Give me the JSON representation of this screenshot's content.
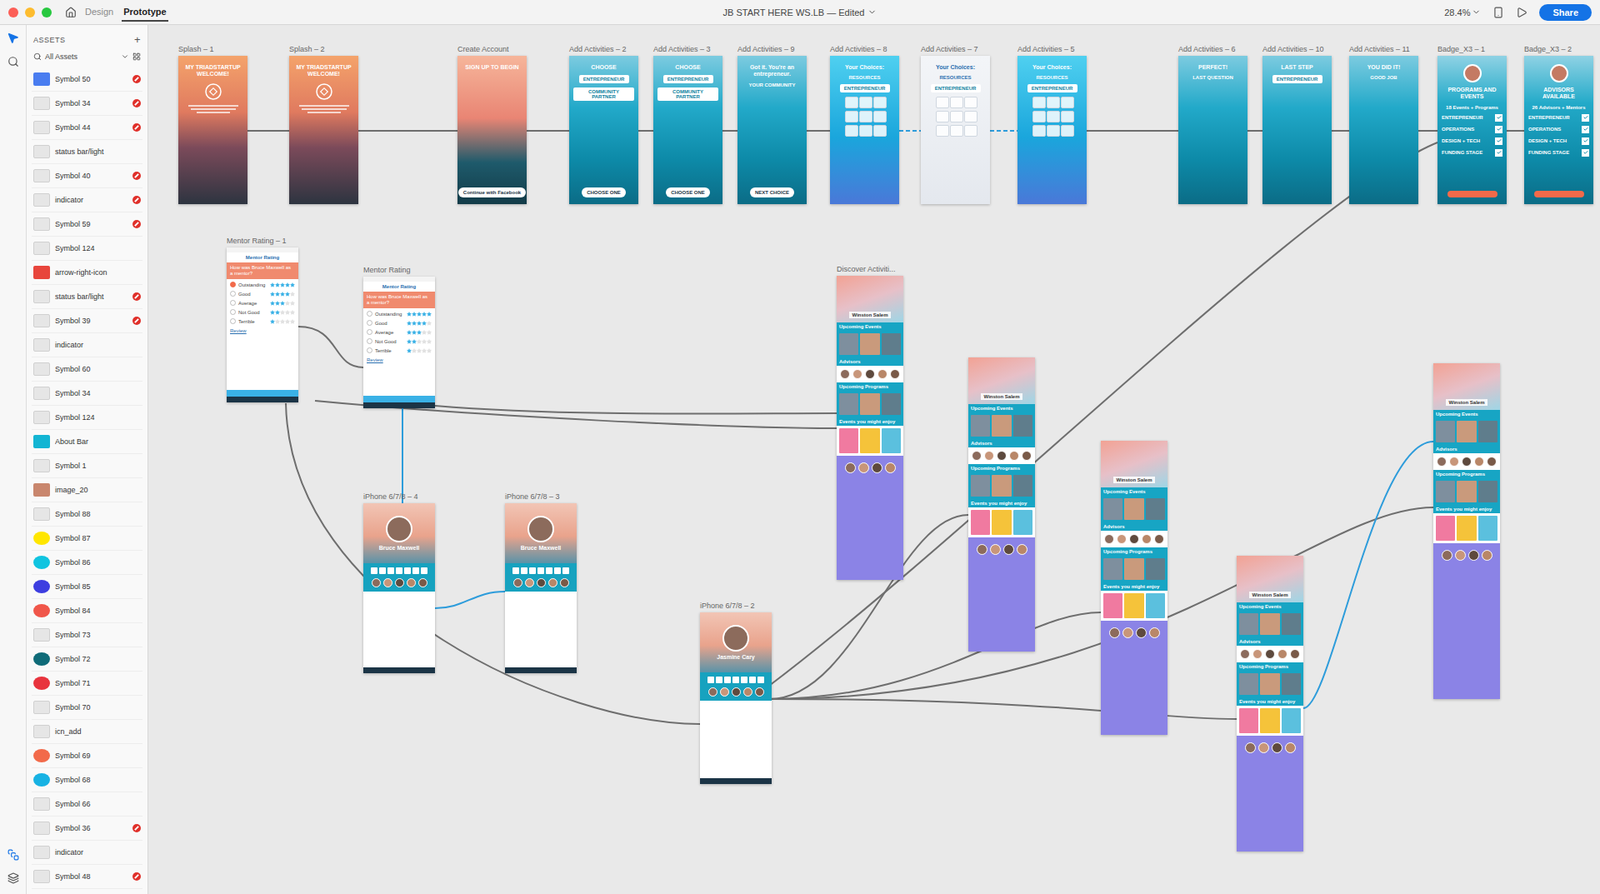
{
  "window": {
    "title": "JB START HERE WS.LB — Edited",
    "tabs": [
      {
        "label": "Design",
        "selected": false
      },
      {
        "label": "Prototype",
        "selected": true
      }
    ],
    "zoom": "28.4%",
    "share": "Share"
  },
  "tools": [
    {
      "selected": true
    },
    {
      "selected": false
    }
  ],
  "assets": {
    "title": "ASSETS",
    "add": "+",
    "filter": "All Assets",
    "items": [
      {
        "name": "Symbol 50",
        "broken": true,
        "color": "#4a7df0"
      },
      {
        "name": "Symbol 34",
        "broken": true
      },
      {
        "name": "Symbol 44",
        "broken": true
      },
      {
        "name": "status bar/light",
        "broken": false
      },
      {
        "name": "Symbol 40",
        "broken": true
      },
      {
        "name": "indicator",
        "broken": true
      },
      {
        "name": "Symbol 59",
        "broken": true
      },
      {
        "name": "Symbol 124",
        "broken": false
      },
      {
        "name": "arrow-right-icon",
        "broken": false,
        "color": "#e8453c"
      },
      {
        "name": "status bar/light",
        "broken": true
      },
      {
        "name": "Symbol 39",
        "broken": true
      },
      {
        "name": "indicator",
        "broken": false
      },
      {
        "name": "Symbol 60",
        "broken": false
      },
      {
        "name": "Symbol 34",
        "broken": false
      },
      {
        "name": "Symbol 124",
        "broken": false
      },
      {
        "name": "About Bar",
        "broken": false,
        "color": "#13b5d3"
      },
      {
        "name": "Symbol 1",
        "broken": false
      },
      {
        "name": "image_20",
        "broken": false,
        "color": "#c9866d"
      },
      {
        "name": "Symbol 88",
        "broken": false
      },
      {
        "name": "Symbol 87",
        "broken": false,
        "color": "#ffe600"
      },
      {
        "name": "Symbol 86",
        "broken": false,
        "color": "#10c4e0"
      },
      {
        "name": "Symbol 85",
        "broken": false,
        "color": "#3d3ee0"
      },
      {
        "name": "Symbol 84",
        "broken": false,
        "color": "#f0564a"
      },
      {
        "name": "Symbol 73",
        "broken": false
      },
      {
        "name": "Symbol 72",
        "broken": false,
        "color": "#0f6b78"
      },
      {
        "name": "Symbol 71",
        "broken": false,
        "color": "#e8333d"
      },
      {
        "name": "Symbol 70",
        "broken": false
      },
      {
        "name": "icn_add",
        "broken": false
      },
      {
        "name": "Symbol 69",
        "broken": false,
        "color": "#f26a4a"
      },
      {
        "name": "Symbol 68",
        "broken": false,
        "color": "#17b2e3"
      },
      {
        "name": "Symbol 66",
        "broken": false
      },
      {
        "name": "Symbol 36",
        "broken": true
      },
      {
        "name": "indicator",
        "broken": false
      },
      {
        "name": "Symbol 48",
        "broken": true
      }
    ]
  },
  "flow": [
    {
      "label": "Splash – 1",
      "kind": "splash",
      "heading": "MY TRIADSTARTUP WELCOME!"
    },
    {
      "label": "Splash – 2",
      "kind": "splash",
      "heading": "MY TRIADSTARTUP WELCOME!"
    },
    {
      "label": "Create Account",
      "kind": "signup",
      "heading": "SIGN UP TO BEGIN",
      "button": "Continue with Facebook"
    },
    {
      "label": "Add Activities – 2",
      "kind": "choice",
      "heading": "CHOOSE",
      "chips": [
        "ENTREPRENEUR",
        "COMMUNITY PARTNER"
      ],
      "button": "CHOOSE ONE"
    },
    {
      "label": "Add Activities – 3",
      "kind": "choice",
      "heading": "CHOOSE",
      "chips": [
        "ENTREPRENEUR",
        "COMMUNITY PARTNER"
      ],
      "button": "CHOOSE ONE"
    },
    {
      "label": "Add Activities – 9",
      "kind": "message",
      "heading": "Got it. You're an entrepreneur.",
      "sub": "YOUR COMMUNITY",
      "button": "NEXT CHOICE"
    },
    {
      "label": "Add Activities – 8",
      "kind": "grid",
      "heading": "Your Choices:",
      "sub": "RESOURCES",
      "chips": [
        "ENTREPRENEUR"
      ]
    },
    {
      "label": "Add Activities – 7",
      "kind": "pale",
      "heading": "Your Choices:",
      "sub": "RESOURCES",
      "chips": [
        "ENTREPRENEUR"
      ]
    },
    {
      "label": "Add Activities – 5",
      "kind": "grid",
      "heading": "Your Choices:",
      "sub": "RESOURCES",
      "chips": [
        "ENTREPRENEUR"
      ]
    },
    {
      "label": "Add Activities – 6",
      "kind": "message",
      "heading": "PERFECT!",
      "sub": "LAST QUESTION"
    },
    {
      "label": "Add Activities – 10",
      "kind": "message",
      "heading": "LAST STEP",
      "chips": [
        "ENTREPRENEUR"
      ]
    },
    {
      "label": "Add Activities – 11",
      "kind": "message",
      "heading": "YOU DID IT!",
      "sub": "GOOD JOB"
    },
    {
      "label": "Badge_X3 – 1",
      "kind": "badge",
      "heading": "PROGRAMS AND EVENTS",
      "sub": "18 Events + Programs",
      "checks": [
        {
          "label": "ENTREPRENEUR",
          "checked": true
        },
        {
          "label": "OPERATIONS",
          "checked": true
        },
        {
          "label": "DESIGN + TECH",
          "checked": true
        },
        {
          "label": "FUNDING STAGE",
          "checked": true
        }
      ]
    },
    {
      "label": "Badge_X3 – 2",
      "kind": "badge",
      "heading": "ADVISORS AVAILABLE",
      "sub": "26 Advisors + Mentors",
      "checks": [
        {
          "label": "ENTREPRENEUR",
          "checked": true
        },
        {
          "label": "OPERATIONS",
          "checked": true
        },
        {
          "label": "DESIGN + TECH",
          "checked": true
        },
        {
          "label": "FUNDING STAGE",
          "checked": true
        }
      ]
    }
  ],
  "ratings": [
    {
      "label": "Mentor Rating – 1",
      "title": "Mentor Rating",
      "question": "How was Bruce Maxwell as a mentor?",
      "link": "Review",
      "options": [
        {
          "label": "Outstanding",
          "stars": 5,
          "selected": true
        },
        {
          "label": "Good",
          "stars": 4,
          "selected": false
        },
        {
          "label": "Average",
          "stars": 3,
          "selected": false
        },
        {
          "label": "Not Good",
          "stars": 2,
          "selected": false
        },
        {
          "label": "Terrible",
          "stars": 1,
          "selected": false
        }
      ]
    },
    {
      "label": "Mentor Rating",
      "title": "Mentor Rating",
      "question": "How was Bruce Maxwell as a mentor?",
      "link": "Review",
      "options": [
        {
          "label": "Outstanding",
          "stars": 5,
          "selected": false
        },
        {
          "label": "Good",
          "stars": 4,
          "selected": false
        },
        {
          "label": "Average",
          "stars": 3,
          "selected": false
        },
        {
          "label": "Not Good",
          "stars": 2,
          "selected": false
        },
        {
          "label": "Terrible",
          "stars": 1,
          "selected": false
        }
      ]
    }
  ],
  "profiles": [
    {
      "label": "iPhone 6/7/8 – 4",
      "name": "Bruce Maxwell"
    },
    {
      "label": "iPhone 6/7/8 – 3",
      "name": "Bruce Maxwell"
    },
    {
      "label": "iPhone 6/7/8 – 2",
      "name": "Jasmine Cary"
    }
  ],
  "feeds": [
    {
      "label": "Discover Activiti...",
      "city": "Winston Salem",
      "sections": [
        "Upcoming Events",
        "Advisors",
        "Upcoming Programs",
        "Events you might enjoy"
      ]
    },
    {
      "city": "Winston Salem",
      "sections": [
        "Upcoming Events",
        "Advisors",
        "Upcoming Programs",
        "Events you might enjoy"
      ]
    },
    {
      "city": "Winston Salem",
      "sections": [
        "Upcoming Events",
        "Advisors",
        "Upcoming Programs",
        "Events you might enjoy"
      ]
    },
    {
      "city": "Winston Salem",
      "sections": [
        "Upcoming Events",
        "Advisors",
        "Upcoming Programs",
        "Events you might enjoy"
      ]
    },
    {
      "city": "Winston Salem",
      "sections": [
        "Upcoming Events",
        "Advisors",
        "Upcoming Programs",
        "Events you might enjoy"
      ]
    }
  ]
}
